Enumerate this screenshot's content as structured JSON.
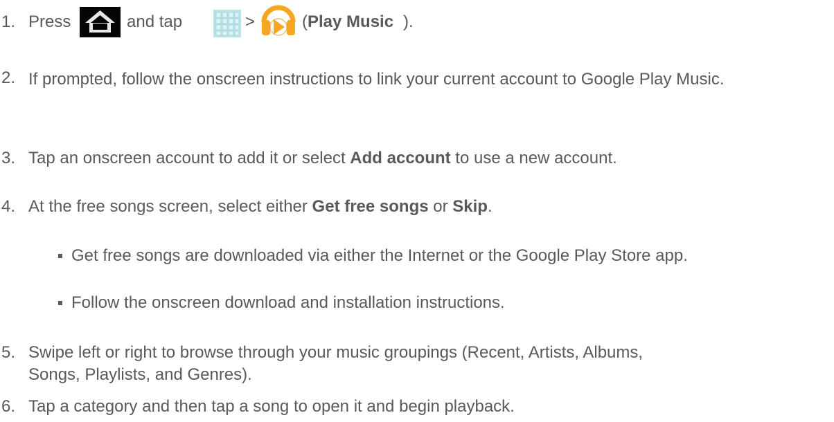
{
  "steps": [
    {
      "number": "1.",
      "press": "Press",
      "and_tap": "and tap",
      "gt": ">",
      "paren_open": "(",
      "app_name": "Play Music",
      "paren_close": ")."
    },
    {
      "number": "2.",
      "text": "If prompted, follow the onscreen instructions to link your current account to Google Play Music."
    },
    {
      "number": "3.",
      "pre": "Tap an onscreen account to add it or select ",
      "bold": "Add account",
      "post": " to use a new account."
    },
    {
      "number": "4.",
      "pre": "At the free songs screen, select either ",
      "bold1": "Get free songs",
      "mid": " or ",
      "bold2": "Skip",
      "post": "."
    },
    {
      "number": "5.",
      "text": "Swipe left or right to browse through your music groupings (Recent, Artists, Albums, Songs, Playlists, and Genres)."
    },
    {
      "number": "6.",
      "text": "Tap a category and then tap a song to open it and begin playback."
    }
  ],
  "substeps": [
    "Get free songs are downloaded via either the Internet or the Google Play Store app.",
    "Follow the onscreen download and installation instructions."
  ],
  "icons": {
    "home": "home-icon",
    "apps": "apps-grid-icon",
    "music": "play-music-icon"
  },
  "colors": {
    "text": "#595959",
    "music_orange": "#F5A623"
  }
}
